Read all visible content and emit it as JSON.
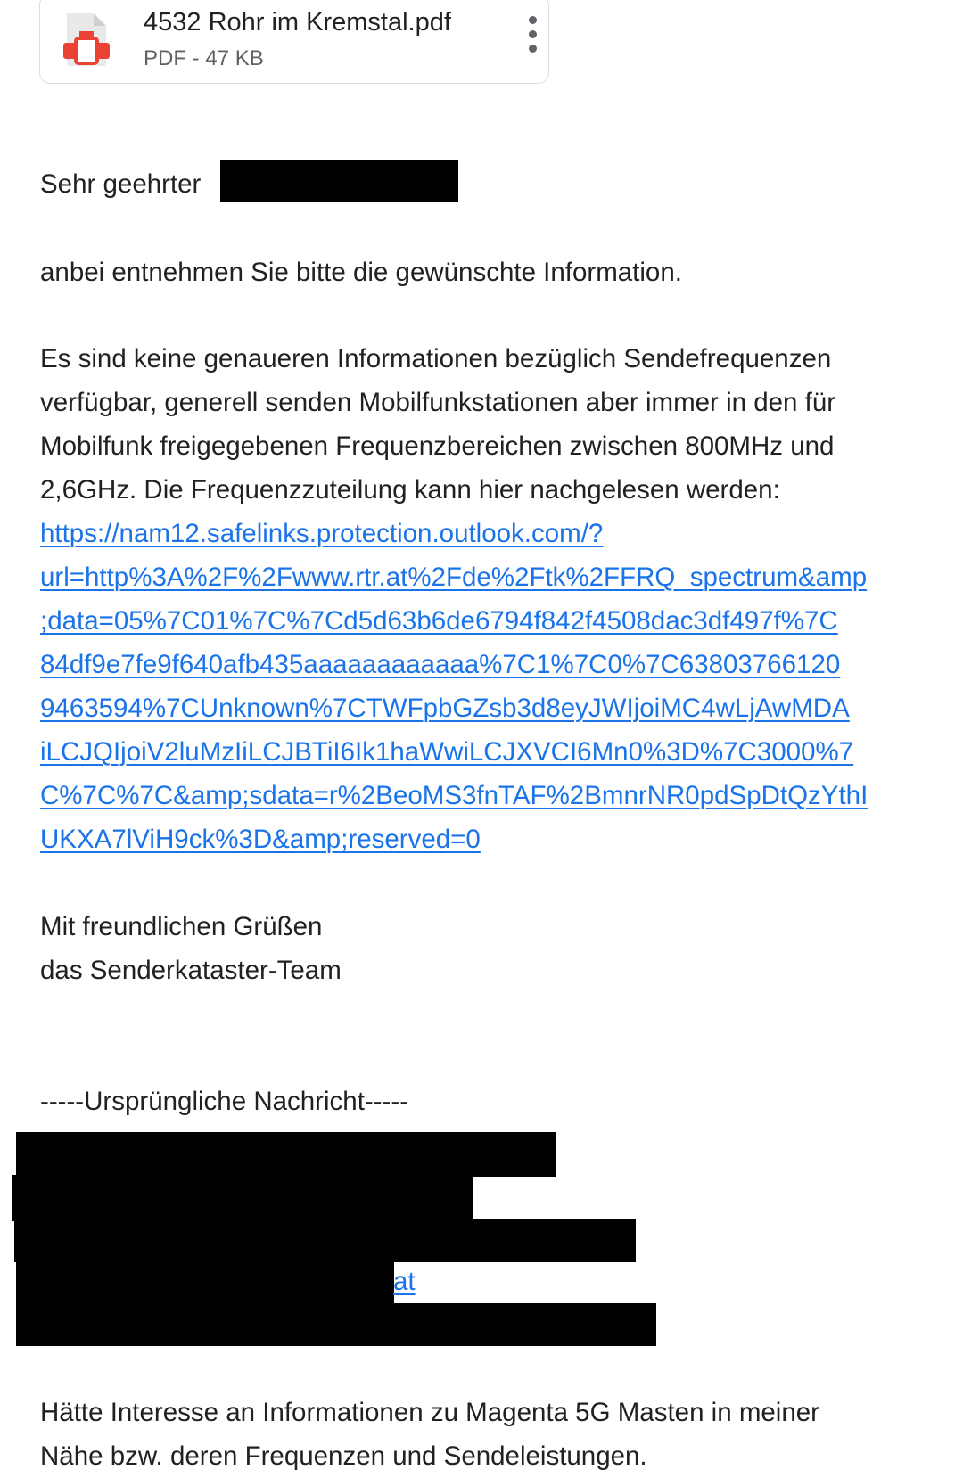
{
  "attachment": {
    "name": "4532 Rohr im Kremstal.pdf",
    "meta": "PDF - 47 KB",
    "icon": "pdf-file-icon",
    "menu_icon": "more-vert-icon"
  },
  "email": {
    "salutation": "Sehr geehrter",
    "intro": "anbei entnehmen Sie bitte die gewünschte Information.",
    "paragraph_lines": [
      "Es sind keine genaueren Informationen bezüglich Sendefrequenzen",
      "verfügbar, generell senden Mobilfunkstationen aber immer in den für",
      "Mobilfunk freigegebenen Frequenzbereichen zwischen 800MHz und",
      "2,6GHz. Die Frequenzzuteilung kann hier nachgelesen werden:"
    ],
    "link_lines": [
      "https://nam12.safelinks.protection.outlook.com/?",
      "url=http%3A%2F%2Fwww.rtr.at%2Fde%2Ftk%2FFRQ_spectrum&amp",
      ";data=05%7C01%7C%7Cd5d63b6de6794f842f4508dac3df497f%7C",
      "84df9e7fe9f640afb435aaaaaaaaaaaa%7C1%7C0%7C63803766120",
      "9463594%7CUnknown%7CTWFpbGZsb3d8eyJWIjoiMC4wLjAwMDA",
      "iLCJQIjoiV2luMzIiLCJBTiI6Ik1haWwiLCJXVCI6Mn0%3D%7C3000%7",
      "C%7C%7C&amp;sdata=r%2BeoMS3fnTAF%2BmnrNR0pdSpDtQzYthI",
      "UKXA7lViH9ck%3D&amp;reserved=0"
    ],
    "closing": "Mit freundlichen Grüßen",
    "signature": "das Senderkataster-Team",
    "original_header": "-----Ursprüngliche Nachricht-----",
    "partial_link": "at",
    "request_lines": [
      "Hätte Interesse an Informationen zu Magenta 5G Masten in meiner",
      "Nähe bzw. deren Frequenzen und Sendeleistungen."
    ]
  },
  "colors": {
    "link": "#1a73e8",
    "pdf_red": "#ea4335",
    "redaction": "#000000"
  }
}
